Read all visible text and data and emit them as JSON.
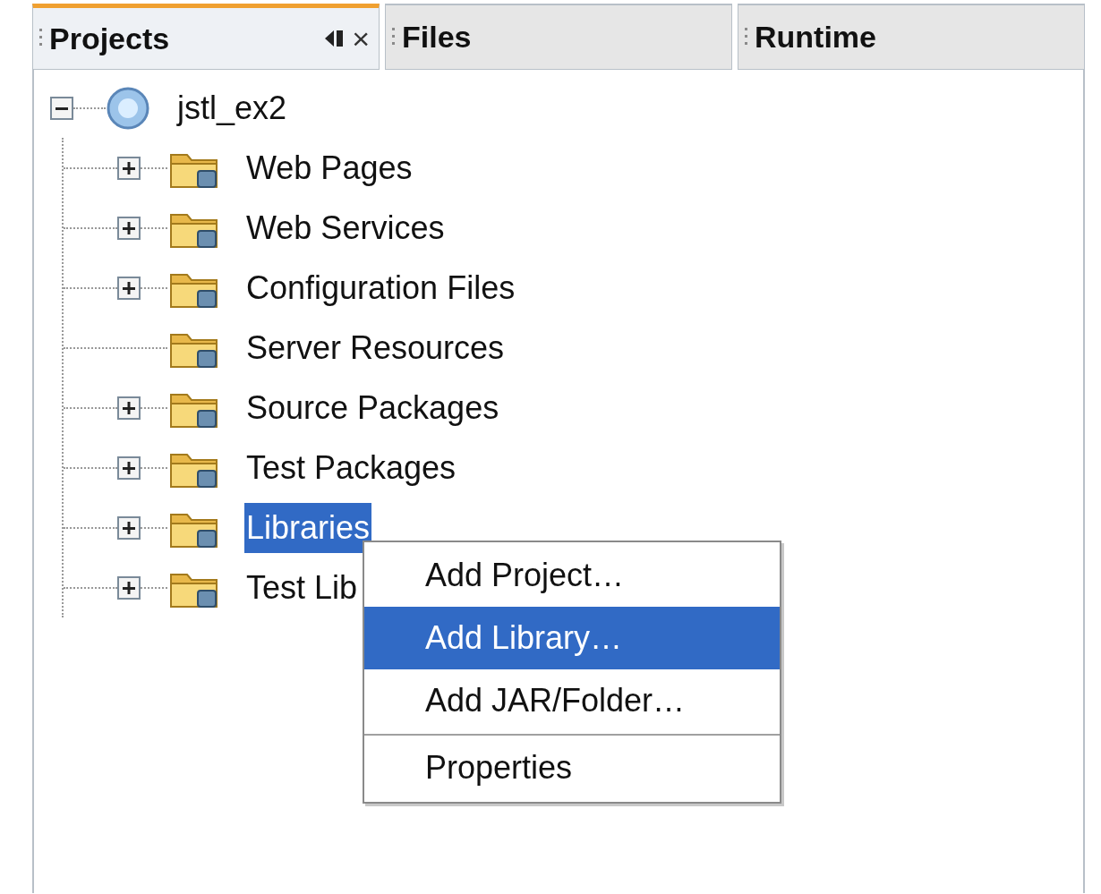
{
  "tabs": [
    {
      "label": "Projects",
      "selected": true,
      "close": "×"
    },
    {
      "label": "Files",
      "selected": false
    },
    {
      "label": "Runtime",
      "selected": false
    }
  ],
  "tree": {
    "label": "jstl_ex2",
    "expanded": true,
    "selected": false,
    "children": [
      {
        "label": "Web Pages",
        "kind": "node",
        "expanded": false,
        "selected": false
      },
      {
        "label": "Web Services",
        "kind": "node",
        "expanded": false,
        "selected": false
      },
      {
        "label": "Configuration Files",
        "kind": "node",
        "expanded": false,
        "selected": false
      },
      {
        "label": "Server Resources",
        "kind": "leaf",
        "selected": false
      },
      {
        "label": "Source Packages",
        "kind": "node",
        "expanded": false,
        "selected": false
      },
      {
        "label": "Test Packages",
        "kind": "node",
        "expanded": false,
        "selected": false
      },
      {
        "label": "Libraries",
        "kind": "node",
        "expanded": false,
        "selected": true
      },
      {
        "label": "Test Lib",
        "kind": "node",
        "expanded": false,
        "selected": false
      }
    ]
  },
  "context_menu": [
    {
      "label": "Add Project…",
      "selected": false,
      "separator_before": false
    },
    {
      "label": "Add Library…",
      "selected": true,
      "separator_before": false
    },
    {
      "label": "Add JAR/Folder…",
      "selected": false,
      "separator_before": false
    },
    {
      "label": "Properties",
      "selected": false,
      "separator_before": true
    }
  ]
}
